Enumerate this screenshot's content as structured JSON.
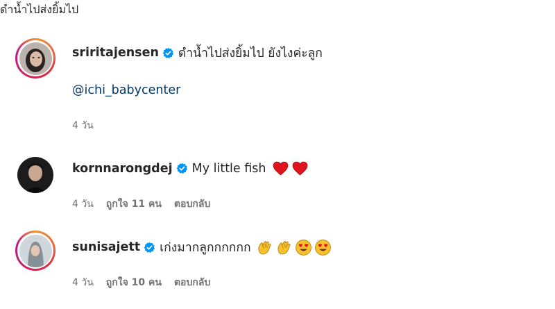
{
  "post_caption": "ดำน้ำไปส่งยิ้มไป",
  "comments": [
    {
      "username": "sriritajensen",
      "verified": true,
      "text": "ดำน้ำไปส่งยิ้มไป ยังไงค่ะลูก",
      "mention": "@ichi_babycenter",
      "time": "4 วัน"
    },
    {
      "username": "kornnarongdej",
      "verified": true,
      "text": "My little fish",
      "emojis": [
        "red-heart",
        "red-heart"
      ],
      "time": "4 วัน",
      "likes": "ถูกใจ 11 คน",
      "reply": "ตอบกลับ"
    },
    {
      "username": "sunisajett",
      "verified": true,
      "text": "เก่งมากลูกกกกกก",
      "emojis": [
        "clapping-hands",
        "clapping-hands",
        "heart-eyes",
        "heart-eyes"
      ],
      "time": "4 วัน",
      "likes": "ถูกใจ 10 คน",
      "reply": "ตอบกลับ"
    }
  ],
  "colors": {
    "verified_blue": "#0095f6",
    "mention_blue": "#00376b",
    "meta_gray": "#737373"
  }
}
